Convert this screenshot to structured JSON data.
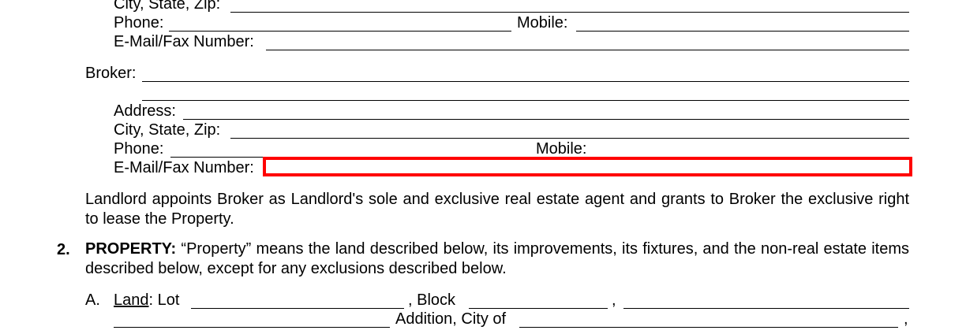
{
  "landlord_contact": {
    "city_state_zip_label": "City, State, Zip:",
    "phone_label": "Phone:",
    "mobile_label": "Mobile:",
    "email_fax_label": "E-Mail/Fax Number:"
  },
  "broker": {
    "broker_label": "Broker:",
    "address_label": "Address:",
    "city_state_zip_label": "City, State, Zip:",
    "phone_label": "Phone:",
    "mobile_label": "Mobile:",
    "email_fax_label": "E-Mail/Fax Number:",
    "email_fax_value": "",
    "highlight_color": "#ff0000"
  },
  "appointment_paragraph": "Landlord appoints Broker as Landlord's sole and exclusive real estate agent and grants to Broker the exclusive right to lease the Property.",
  "section2": {
    "number": "2.",
    "heading": "PROPERTY:",
    "body": "“Property” means the land described below, its improvements, its fixtures, and the non-real estate items described below, except for any exclusions described below."
  },
  "land": {
    "letter": "A.",
    "label": "Land",
    "lot_text": ": Lot",
    "block_text": ", Block",
    "comma": ",",
    "addition_text": "Addition, City of",
    "trailing_comma": ","
  }
}
